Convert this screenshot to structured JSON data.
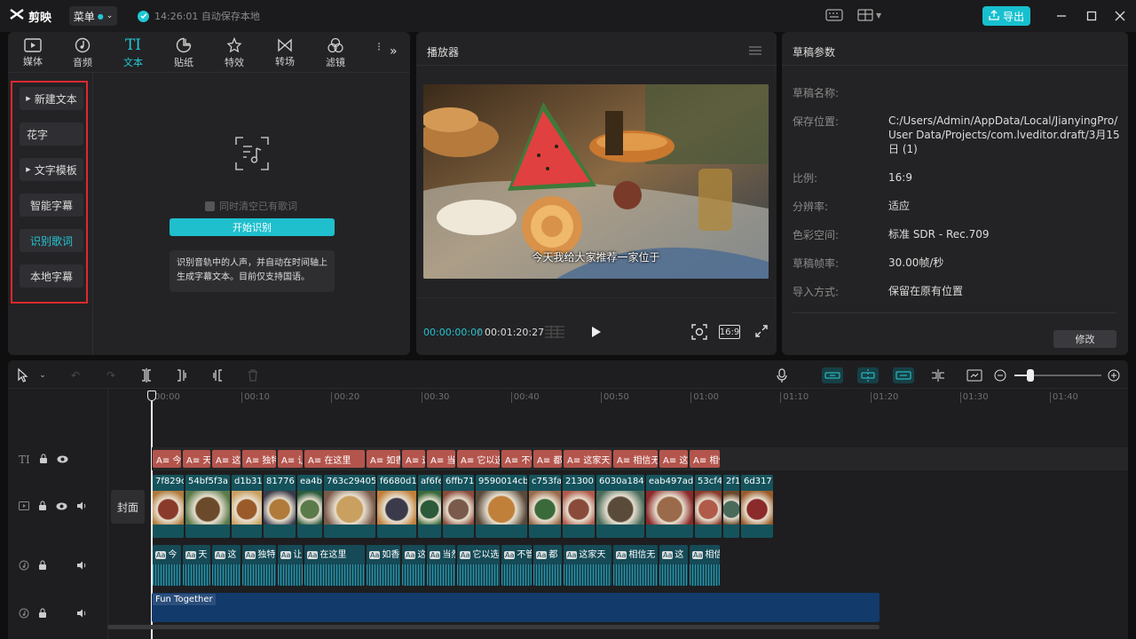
{
  "app": {
    "name": "剪映",
    "menu_label": "菜单",
    "autosave": "14:26:01 自动保存本地",
    "export_label": "导出"
  },
  "left_tabs": [
    {
      "label": "媒体",
      "icon": "media-icon"
    },
    {
      "label": "音频",
      "icon": "audio-icon"
    },
    {
      "label": "文本",
      "icon": "text-icon",
      "active": true
    },
    {
      "label": "贴纸",
      "icon": "sticker-icon"
    },
    {
      "label": "特效",
      "icon": "effects-icon"
    },
    {
      "label": "转场",
      "icon": "transition-icon"
    },
    {
      "label": "滤镜",
      "icon": "filter-icon"
    }
  ],
  "side_items": [
    {
      "label": "新建文本",
      "expandable": true
    },
    {
      "label": "花字"
    },
    {
      "label": "文字模板",
      "expandable": true
    },
    {
      "label": "智能字幕"
    },
    {
      "label": "识别歌词",
      "active": true
    },
    {
      "label": "本地字幕"
    }
  ],
  "lyrics": {
    "clear_checkbox": "同时清空已有歌词",
    "start_button": "开始识别",
    "tip": "识别音轨中的人声，并自动在时间轴上生成字幕文本。目前仅支持国语。"
  },
  "player": {
    "title": "播放器",
    "subtitle": "今天我给大家推荐一家位于",
    "current_time": "00:00:00:00",
    "total_time": "00:01:20:27",
    "ratio_label": "16:9"
  },
  "draft": {
    "title": "草稿参数",
    "rows": [
      {
        "key": "草稿名称:",
        "value": ""
      },
      {
        "key": "保存位置:",
        "value": "C:/Users/Admin/AppData/Local/JianyingPro/User Data/Projects/com.lveditor.draft/3月15日 (1)"
      },
      {
        "key": "比例:",
        "value": "16:9"
      },
      {
        "key": "分辨率:",
        "value": "适应"
      },
      {
        "key": "色彩空间:",
        "value": "标准 SDR - Rec.709"
      },
      {
        "key": "草稿帧率:",
        "value": "30.00帧/秒"
      },
      {
        "key": "导入方式:",
        "value": "保留在原有位置"
      }
    ],
    "modify_label": "修改"
  },
  "timeline": {
    "ruler": [
      "00:00",
      "00:10",
      "00:20",
      "00:30",
      "00:40",
      "00:50",
      "01:00",
      "01:10",
      "01:20",
      "01:30",
      "01:40"
    ],
    "cover_label": "封面",
    "text_clips": [
      "A≡ 今天",
      "A≡ 天",
      "A≡ 这",
      "A≡ 独特",
      "A≡ 让",
      "A≡ 在这里",
      "A≡ 如香",
      "A≡ 这",
      "A≡ 当然",
      "A≡ 它以选",
      "A≡ 不管",
      "A≡ 都",
      "A≡ 这家天",
      "A≡ 相信无",
      "A≡ 这",
      "A≡ 相信"
    ],
    "video_clips": [
      "7f829c",
      "54bf5f3a",
      "d1b31",
      "81776",
      "ea4b",
      "763c29405",
      "f6680d12",
      "af6fe",
      "6ffb71",
      "9590014cb",
      "c753fa",
      "21300",
      "6030a1848",
      "eab497ad",
      "53cf4",
      "2f1",
      "6d317"
    ],
    "audio_clips": [
      "今",
      "天",
      "这",
      "独特",
      "让",
      "在这里",
      "如香",
      "这",
      "当然",
      "它以选",
      "不管",
      "都",
      "这家天",
      "相信无",
      "这",
      "相信"
    ],
    "music_label": "Fun Together"
  }
}
